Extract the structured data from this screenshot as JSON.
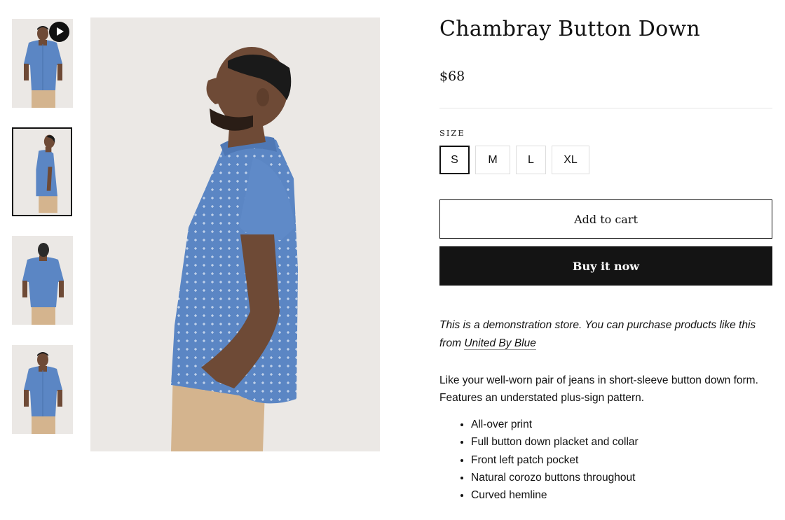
{
  "product": {
    "title": "Chambray Button Down",
    "price": "$68"
  },
  "gallery": {
    "thumbnails": [
      {
        "view": "front",
        "has_video": true,
        "selected": false
      },
      {
        "view": "side",
        "has_video": false,
        "selected": true
      },
      {
        "view": "back",
        "has_video": false,
        "selected": false
      },
      {
        "view": "front",
        "has_video": false,
        "selected": false
      }
    ],
    "main_view": "side"
  },
  "size_selector": {
    "label": "SIZE",
    "options": [
      "S",
      "M",
      "L",
      "XL"
    ],
    "selected": "S"
  },
  "actions": {
    "add_to_cart": "Add to cart",
    "buy_now": "Buy it now"
  },
  "demo_note": {
    "text": "This is a demonstration store. You can purchase products like this from ",
    "link_text": "United By Blue"
  },
  "description": "Like your well-worn pair of jeans in short-sleeve button down form. Features an understated plus-sign pattern.",
  "features": [
    "All-over print",
    "Full button down placket and collar",
    "Front left patch pocket",
    "Natural corozo buttons throughout",
    "Curved hemline"
  ],
  "colors": {
    "shirt": "#5b86c4",
    "pants": "#d4b48e",
    "skin": "#6e4a36",
    "background": "#ebe8e5",
    "button_dark": "#141414"
  }
}
